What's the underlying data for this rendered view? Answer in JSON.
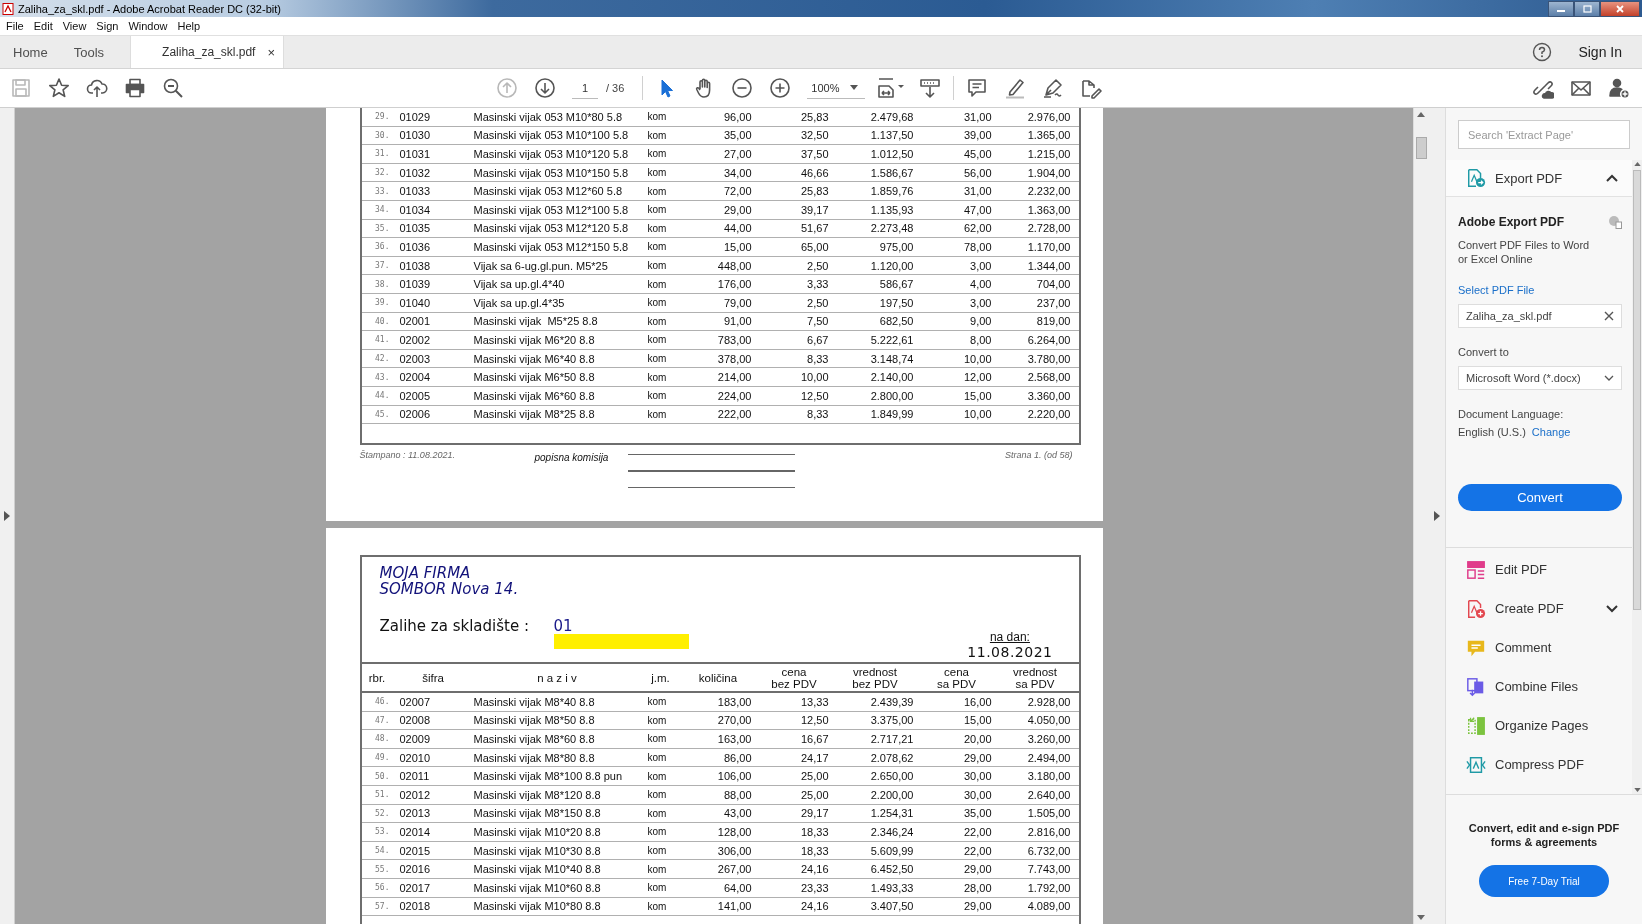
{
  "window": {
    "title": "Zaliha_za_skl.pdf - Adobe Acrobat Reader DC (32-bit)"
  },
  "menu": [
    "File",
    "Edit",
    "View",
    "Sign",
    "Window",
    "Help"
  ],
  "tabs": [
    {
      "label": "Home",
      "selected": false
    },
    {
      "label": "Tools",
      "selected": false
    },
    {
      "label": "Zaliha_za_skl.pdf",
      "selected": true,
      "close": "×"
    }
  ],
  "sign_in": "Sign In",
  "toolbar": {
    "save_disabled": true,
    "prev_page_disabled": true,
    "page": "1",
    "page_total": "/ 36",
    "zoom": "100%"
  },
  "page_1": {
    "rows": [
      [
        "29.",
        "01029",
        "Masinski vijak 053 M10*80 5.8",
        "kom",
        "96,00",
        "25,83",
        "2.479,68",
        "31,00",
        "2.976,00"
      ],
      [
        "30.",
        "01030",
        "Masinski vijak 053 M10*100 5.8",
        "kom",
        "35,00",
        "32,50",
        "1.137,50",
        "39,00",
        "1.365,00"
      ],
      [
        "31.",
        "01031",
        "Masinski vijak 053 M10*120 5.8",
        "kom",
        "27,00",
        "37,50",
        "1.012,50",
        "45,00",
        "1.215,00"
      ],
      [
        "32.",
        "01032",
        "Masinski vijak 053 M10*150 5.8",
        "kom",
        "34,00",
        "46,66",
        "1.586,67",
        "56,00",
        "1.904,00"
      ],
      [
        "33.",
        "01033",
        "Masinski vijak 053 M12*60 5.8",
        "kom",
        "72,00",
        "25,83",
        "1.859,76",
        "31,00",
        "2.232,00"
      ],
      [
        "34.",
        "01034",
        "Masinski vijak 053 M12*100 5.8",
        "kom",
        "29,00",
        "39,17",
        "1.135,93",
        "47,00",
        "1.363,00"
      ],
      [
        "35.",
        "01035",
        "Masinski vijak 053 M12*120 5.8",
        "kom",
        "44,00",
        "51,67",
        "2.273,48",
        "62,00",
        "2.728,00"
      ],
      [
        "36.",
        "01036",
        "Masinski vijak 053 M12*150 5.8",
        "kom",
        "15,00",
        "65,00",
        "975,00",
        "78,00",
        "1.170,00"
      ],
      [
        "37.",
        "01038",
        "Vijak sa 6-ug.gl.pun. M5*25",
        "kom",
        "448,00",
        "2,50",
        "1.120,00",
        "3,00",
        "1.344,00"
      ],
      [
        "38.",
        "01039",
        "Vijak sa up.gl.4*40",
        "kom",
        "176,00",
        "3,33",
        "586,67",
        "4,00",
        "704,00"
      ],
      [
        "39.",
        "01040",
        "Vijak sa up.gl.4*35",
        "kom",
        "79,00",
        "2,50",
        "197,50",
        "3,00",
        "237,00"
      ],
      [
        "40.",
        "02001",
        "Masinski vijak  M5*25 8.8",
        "kom",
        "91,00",
        "7,50",
        "682,50",
        "9,00",
        "819,00"
      ],
      [
        "41.",
        "02002",
        "Masinski vijak M6*20 8.8",
        "kom",
        "783,00",
        "6,67",
        "5.222,61",
        "8,00",
        "6.264,00"
      ],
      [
        "42.",
        "02003",
        "Masinski vijak M6*40 8.8",
        "kom",
        "378,00",
        "8,33",
        "3.148,74",
        "10,00",
        "3.780,00"
      ],
      [
        "43.",
        "02004",
        "Masinski vijak M6*50 8.8",
        "kom",
        "214,00",
        "10,00",
        "2.140,00",
        "12,00",
        "2.568,00"
      ],
      [
        "44.",
        "02005",
        "Masinski vijak M6*60 8.8",
        "kom",
        "224,00",
        "12,50",
        "2.800,00",
        "15,00",
        "3.360,00"
      ],
      [
        "45.",
        "02006",
        "Masinski vijak M8*25 8.8",
        "kom",
        "222,00",
        "8,33",
        "1.849,99",
        "10,00",
        "2.220,00"
      ]
    ],
    "footer": {
      "printed": "Štampano : 11.08.2021.",
      "committee": "popisna komisija",
      "page": "Strana 1. (od 58)"
    }
  },
  "page_2": {
    "company": [
      "MOJA FIRMA",
      "SOMBOR Nova 14."
    ],
    "warehouse_label": "Zalihe za skladište :",
    "warehouse": "01",
    "warehouse_redacted": true,
    "date_label": "na dan:",
    "date": "11.08.2021",
    "columns": [
      "rbr.",
      "šifra",
      "n a z i v",
      "j.m.",
      "količina",
      "cena\nbez PDV",
      "vrednost\nbez PDV",
      "cena\nsa PDV",
      "vrednost\nsa PDV"
    ],
    "rows": [
      [
        "46.",
        "02007",
        "Masinski vijak M8*40 8.8",
        "kom",
        "183,00",
        "13,33",
        "2.439,39",
        "16,00",
        "2.928,00"
      ],
      [
        "47.",
        "02008",
        "Masinski vijak M8*50 8.8",
        "kom",
        "270,00",
        "12,50",
        "3.375,00",
        "15,00",
        "4.050,00"
      ],
      [
        "48.",
        "02009",
        "Masinski vijak M8*60 8.8",
        "kom",
        "163,00",
        "16,67",
        "2.717,21",
        "20,00",
        "3.260,00"
      ],
      [
        "49.",
        "02010",
        "Masinski vijak M8*80 8.8",
        "kom",
        "86,00",
        "24,17",
        "2.078,62",
        "29,00",
        "2.494,00"
      ],
      [
        "50.",
        "02011",
        "Masinski vijak M8*100 8.8 pun",
        "kom",
        "106,00",
        "25,00",
        "2.650,00",
        "30,00",
        "3.180,00"
      ],
      [
        "51.",
        "02012",
        "Masinski vijak M8*120 8.8",
        "kom",
        "88,00",
        "25,00",
        "2.200,00",
        "30,00",
        "2.640,00"
      ],
      [
        "52.",
        "02013",
        "Masinski vijak M8*150 8.8",
        "kom",
        "43,00",
        "29,17",
        "1.254,31",
        "35,00",
        "1.505,00"
      ],
      [
        "53.",
        "02014",
        "Masinski vijak M10*20 8.8",
        "kom",
        "128,00",
        "18,33",
        "2.346,24",
        "22,00",
        "2.816,00"
      ],
      [
        "54.",
        "02015",
        "Masinski vijak M10*30 8.8",
        "kom",
        "306,00",
        "18,33",
        "5.609,99",
        "22,00",
        "6.732,00"
      ],
      [
        "55.",
        "02016",
        "Masinski vijak M10*40 8.8",
        "kom",
        "267,00",
        "24,16",
        "6.452,50",
        "29,00",
        "7.743,00"
      ],
      [
        "56.",
        "02017",
        "Masinski vijak M10*60 8.8",
        "kom",
        "64,00",
        "23,33",
        "1.493,33",
        "28,00",
        "1.792,00"
      ],
      [
        "57.",
        "02018",
        "Masinski vijak M10*80 8.8",
        "kom",
        "141,00",
        "24,16",
        "3.407,50",
        "29,00",
        "4.089,00"
      ]
    ]
  },
  "panel": {
    "search": {
      "placeholder": "Search 'Extract Page'"
    },
    "export": {
      "title": "Export PDF",
      "expanded": true,
      "heading": "Adobe Export PDF",
      "description": "Convert PDF Files to Word or Excel Online",
      "select_label": "Select PDF File",
      "file": "Zaliha_za_skl.pdf",
      "convert_to_label": "Convert to",
      "format": "Microsoft Word (*.docx)",
      "language_label": "Document Language:",
      "language": "English (U.S.)",
      "change_link": "Change",
      "convert_button": "Convert"
    },
    "tools": [
      {
        "label": "Edit PDF",
        "kind": "edit",
        "color": "#e03c8a",
        "expandable": false
      },
      {
        "label": "Create PDF",
        "kind": "create",
        "color": "#e34850",
        "expandable": true
      },
      {
        "label": "Comment",
        "kind": "comment",
        "color": "#e8b81c",
        "expandable": false
      },
      {
        "label": "Combine Files",
        "kind": "combine",
        "color": "#6b5be6",
        "expandable": false
      },
      {
        "label": "Organize Pages",
        "kind": "organize",
        "color": "#7cc33f",
        "expandable": false
      },
      {
        "label": "Compress PDF",
        "kind": "compress",
        "color": "#1f9aa6",
        "expandable": false
      }
    ],
    "promo": {
      "text": "Convert, edit and e-sign PDF forms & agreements",
      "button": "Free 7-Day Trial"
    }
  }
}
